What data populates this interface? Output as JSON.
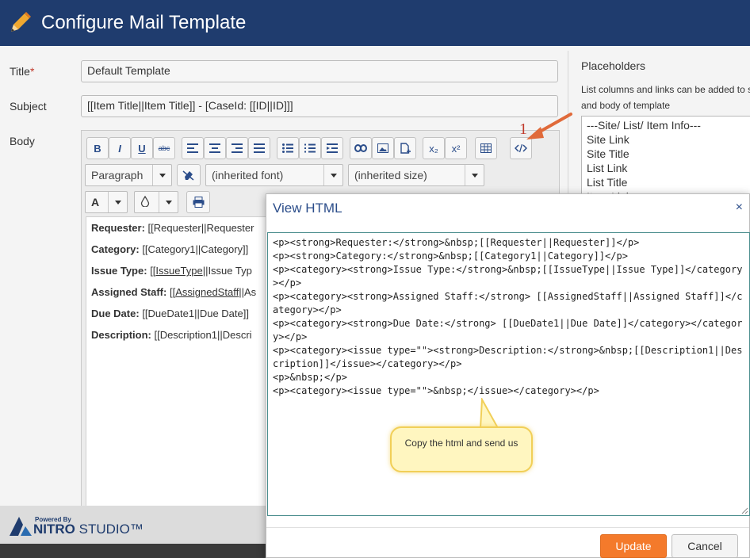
{
  "header": {
    "title": "Configure Mail Template"
  },
  "form": {
    "title_label": "Title",
    "required_mark": "*",
    "title_value": "Default Template",
    "subject_label": "Subject",
    "subject_value": "[[Item Title||Item Title]] - [CaseId: [[ID||ID]]]",
    "body_label": "Body"
  },
  "editor": {
    "toolbar": {
      "bold": "B",
      "italic": "I",
      "underline": "U",
      "strike": "abc",
      "subscript": "x₂",
      "superscript": "x²",
      "paragraph": "Paragraph",
      "font": "(inherited font)",
      "size": "(inherited size)",
      "font_color": "A"
    },
    "lines": [
      {
        "label": "Requester:",
        "value": "[[Requester||Requester"
      },
      {
        "label": "Category:",
        "value": "[[Category1||Category]]"
      },
      {
        "label": "Issue Type:",
        "value_pre": "[[",
        "value_u": "IssueType",
        "value_post": "||Issue Typ"
      },
      {
        "label": "Assigned Staff:",
        "value_pre": "[[",
        "value_u": "AssignedStaff",
        "value_post": "||As"
      },
      {
        "label": "Due Date:",
        "value": "[[DueDate1||Due Date]]"
      },
      {
        "label": "Description:",
        "value": "[[Description1||Descri"
      }
    ]
  },
  "placeholders": {
    "title": "Placeholders",
    "desc_line1": "List columns and links can be added to s",
    "desc_line2": "and body of template",
    "items": [
      "---Site/ List/ Item Info---",
      "Site Link",
      "Site Title",
      "List Link",
      "List Title",
      "Item Link"
    ]
  },
  "footer": {
    "powered_by": "Powered By",
    "brand_bold": "NITRO",
    "brand_rest": " STUDIO™"
  },
  "modal": {
    "title": "View HTML",
    "close": "×",
    "code_lines": [
      "<p><strong>Requester:</strong>&nbsp;[[Requester||Requester]]</p>",
      "<p><strong>Category:</strong>&nbsp;[[Category1||Category]]</p>",
      "<p><category><strong>Issue Type:</strong>&nbsp;[[IssueType||Issue Type]]</category></p>",
      "<p><category><strong>Assigned Staff:</strong> [[AssignedStaff||Assigned Staff]]</category></p>",
      "<p><category><strong>Due Date:</strong> [[DueDate1||Due Date]]</category></category></p>",
      "<p><category><issue type=\"\"><strong>Description:</strong>&nbsp;[[Description1||Description]]</issue></category></p>",
      "<p>&nbsp;</p>",
      "<p><category><issue type=\"\">&nbsp;</issue></category></p>"
    ],
    "update": "Update",
    "cancel": "Cancel"
  },
  "annotations": {
    "step_number": "1",
    "callout_text": "Copy the html and send us"
  },
  "colors": {
    "header_bg": "#1f3c6e",
    "accent_blue": "#2b4d8a",
    "update_orange": "#f47a2b",
    "annotation_red": "#c0392b",
    "callout_yellow": "#fff6c0"
  }
}
